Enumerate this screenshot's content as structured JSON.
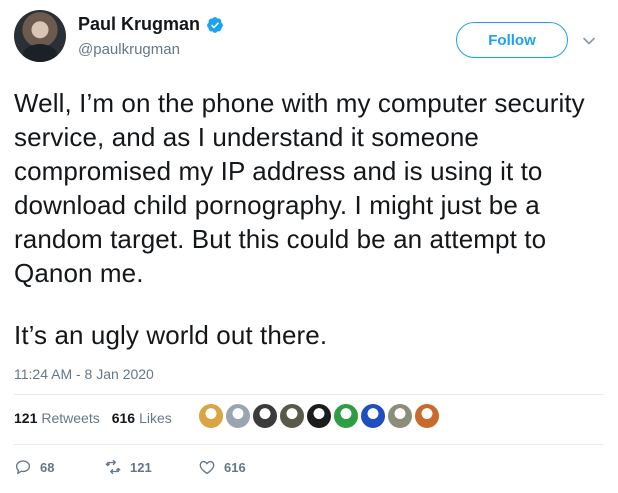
{
  "author": {
    "display_name": "Paul Krugman",
    "handle": "@paulkrugman",
    "verified": true
  },
  "follow_button": {
    "label": "Follow"
  },
  "tweet": {
    "paragraphs": [
      "Well, I’m on the phone with my computer security service, and as I understand it someone compromised my IP address and is using it to download child pornography. I might just be a random target. But this could be an attempt to Qanon me.",
      "It’s an ugly world out there."
    ],
    "timestamp": "11:24 AM - 8 Jan 2020"
  },
  "stats": {
    "retweets_count": "121",
    "retweets_label": "Retweets",
    "likes_count": "616",
    "likes_label": "Likes"
  },
  "likers": [
    {
      "icon": "avatar-dog",
      "color": "#d9a441"
    },
    {
      "icon": "avatar-default",
      "color": "#9aa5b1"
    },
    {
      "icon": "avatar-person",
      "color": "#3b3b3b"
    },
    {
      "icon": "avatar-person",
      "color": "#5a5a4a"
    },
    {
      "icon": "avatar-silhouette",
      "color": "#1c1c1c"
    },
    {
      "icon": "avatar-green",
      "color": "#2e9e44"
    },
    {
      "icon": "avatar-blue",
      "color": "#1e4fbf"
    },
    {
      "icon": "avatar-building",
      "color": "#8b8f7a"
    },
    {
      "icon": "avatar-flower",
      "color": "#c86a2a"
    }
  ],
  "actions": {
    "replies": "68",
    "retweets": "121",
    "likes": "616"
  },
  "colors": {
    "accent": "#1da1f2",
    "secondary_text": "#657786",
    "divider": "#e6ecf0"
  }
}
